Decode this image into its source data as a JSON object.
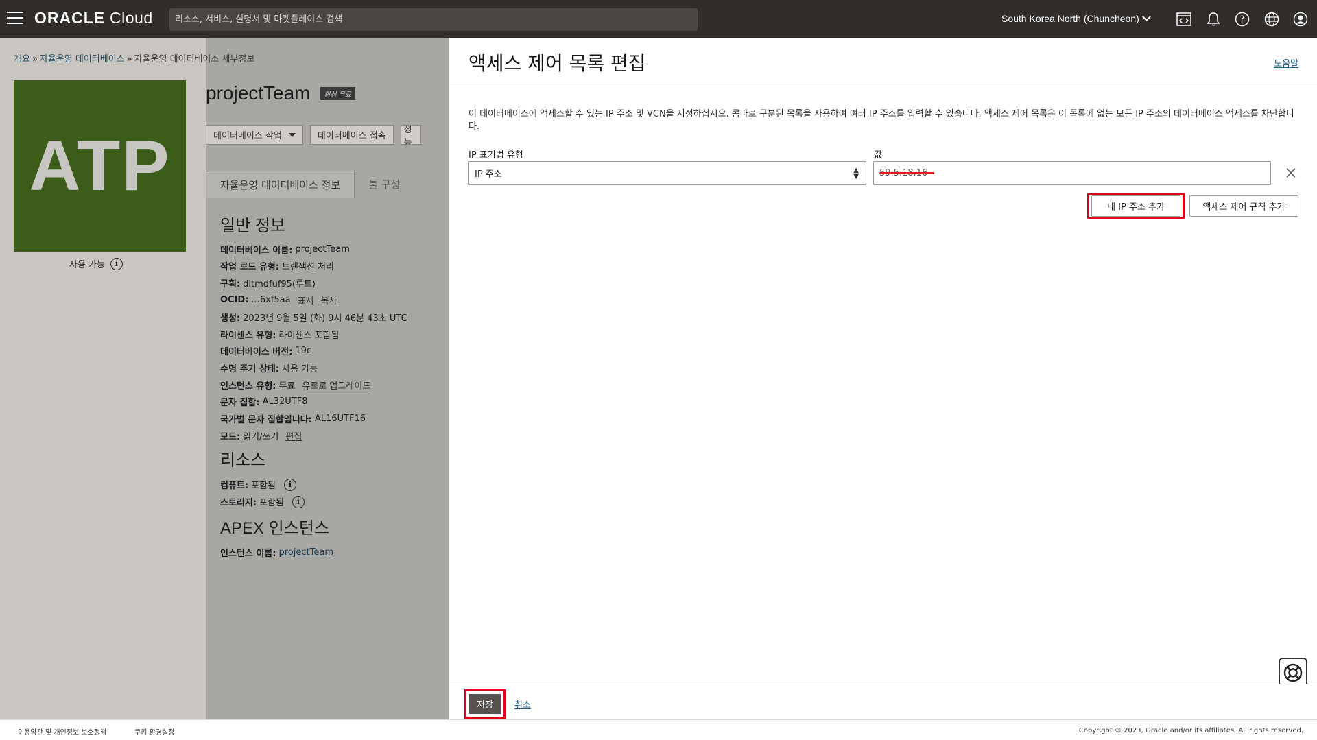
{
  "topbar": {
    "logo_oracle": "ORACLE",
    "logo_cloud": " Cloud",
    "search_placeholder": "리소스, 서비스, 설명서 및 마켓플레이스 검색",
    "region": "South Korea North (Chuncheon)",
    "icons": [
      "code-editor-icon",
      "bell-icon",
      "help-icon",
      "globe-icon",
      "user-icon"
    ]
  },
  "background": {
    "breadcrumb": [
      "개요",
      "자율운영 데이터베이스",
      "자율운영 데이터베이스 세부정보"
    ],
    "breadcrumb_sep": "»",
    "tile_text": "ATP",
    "status": "사용 가능",
    "db_name": "projectTeam",
    "badge": "항상 무료",
    "buttons": [
      "데이터베이스 작업",
      "데이터베이스 접속",
      "성능"
    ],
    "tabs": [
      "자율운영 데이터베이스 정보",
      "툴 구성"
    ],
    "general_heading": "일반 정보",
    "general": [
      {
        "k": "데이터베이스 이름:",
        "v": "projectTeam"
      },
      {
        "k": "작업 로드 유형:",
        "v": "트랜잭션 처리"
      },
      {
        "k": "구획:",
        "v": "dltmdfuf95(루트)"
      },
      {
        "k": "OCID:",
        "v": "...6xf5aa",
        "links": [
          "표시",
          "복사"
        ]
      },
      {
        "k": "생성:",
        "v": "2023년 9월 5일 (화) 9시 46분 43초 UTC"
      },
      {
        "k": "라이센스 유형:",
        "v": "라이센스 포함됨"
      },
      {
        "k": "데이터베이스 버전:",
        "v": "19c"
      },
      {
        "k": "수명 주기 상태:",
        "v": "사용 가능"
      },
      {
        "k": "인스턴스 유형:",
        "v": "무료",
        "links": [
          "유료로 업그레이드"
        ]
      },
      {
        "k": "문자 집합:",
        "v": "AL32UTF8"
      },
      {
        "k": "국가별 문자 집합입니다:",
        "v": "AL16UTF16"
      },
      {
        "k": "모드:",
        "v": "읽기/쓰기",
        "links": [
          "편집"
        ]
      }
    ],
    "resources_heading": "리소스",
    "resources": [
      {
        "k": "컴퓨트:",
        "v": "포함됨"
      },
      {
        "k": "스토리지:",
        "v": "포함됨"
      }
    ],
    "apex_heading": "APEX 인스턴스",
    "apex_label": "인스턴스 이름:",
    "apex_value": "projectTeam"
  },
  "panel": {
    "title": "액세스 제어 목록 편집",
    "help": "도움말",
    "description": "이 데이터베이스에 액세스할 수 있는 IP 주소 및 VCN을 지정하십시오. 콤마로 구분된 목록을 사용하여 여러 IP 주소를 입력할 수 있습니다. 액세스 제어 목록은 이 목록에 없는 모든 IP 주소의 데이터베이스 액세스를 차단합니다.",
    "ip_type_label": "IP 표기법 유형",
    "ip_type_value": "IP 주소",
    "value_label": "값",
    "value": "59.5.18.16",
    "add_my_ip": "내 IP 주소 추가",
    "add_rule": "액세스 제어 규칙 추가",
    "save": "저장",
    "cancel": "취소"
  },
  "footer": {
    "terms": "이용약관 및 개인정보 보호정책",
    "cookies": "쿠키 환경설정",
    "copyright": "Copyright © 2023, Oracle and/or its affiliates. All rights reserved."
  },
  "colors": {
    "topbar": "#312d2a",
    "highlight": "#e2001a",
    "tile": "#3c5d1a",
    "link": "#1b5e8b"
  }
}
